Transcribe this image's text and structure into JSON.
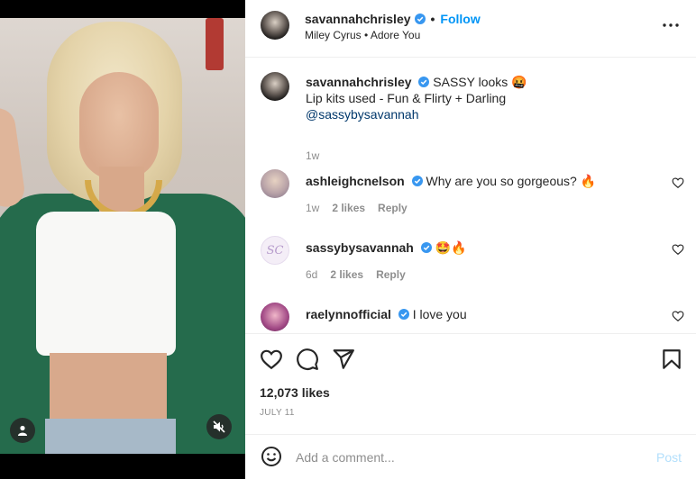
{
  "post": {
    "username": "savannahchrisley",
    "follow_label": "Follow",
    "audio": "Miley Cyrus • Adore You",
    "caption": {
      "username": "savannahchrisley",
      "line1": "SASSY looks 🤬",
      "line2": "Lip kits used - Fun & Flirty + Darling",
      "mention": "@sassybysavannah",
      "time": "1w"
    },
    "comments": [
      {
        "username": "ashleighcnelson",
        "text": "Why are you so gorgeous? 🔥",
        "time": "1w",
        "likes": "2 likes",
        "reply": "Reply"
      },
      {
        "username": "sassybysavannah",
        "text": "🤩🔥",
        "time": "6d",
        "likes": "2 likes",
        "reply": "Reply",
        "avatar_initials": "SC"
      },
      {
        "username": "raelynnofficial",
        "text": "I love you"
      }
    ],
    "likes": "12,073 likes",
    "date": "JULY 11",
    "comment_placeholder": "Add a comment...",
    "post_label": "Post"
  },
  "colors": {
    "accent": "#0095f6",
    "verified": "#3897f0",
    "muted": "#8e8e8e",
    "post_disabled": "#b2dffc"
  },
  "icons": [
    "tag-person-icon",
    "mute-icon",
    "more-icon",
    "heart-icon",
    "comment-icon",
    "share-icon",
    "bookmark-icon",
    "emoji-icon"
  ]
}
